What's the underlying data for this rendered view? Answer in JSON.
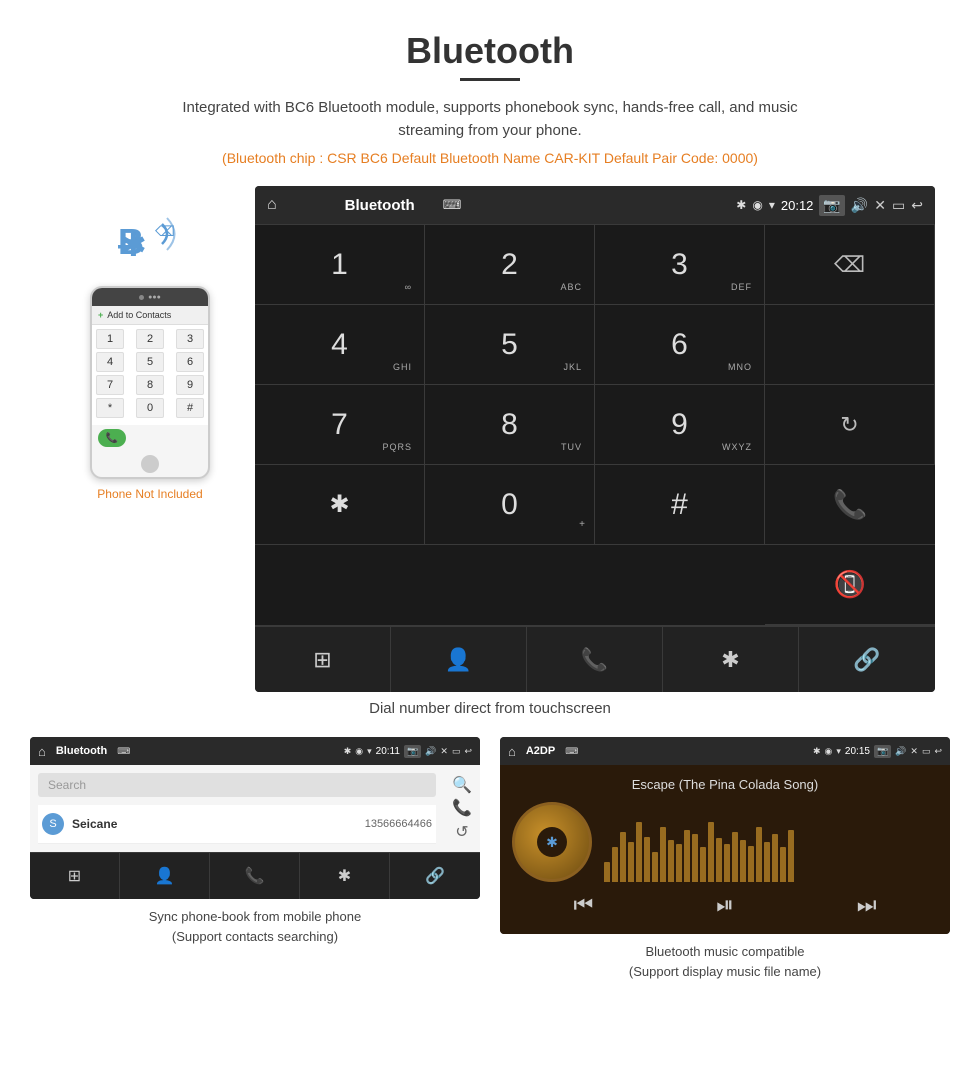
{
  "page": {
    "title": "Bluetooth",
    "subtitle": "Integrated with BC6 Bluetooth module, supports phonebook sync, hands-free call, and music streaming from your phone.",
    "orange_info": "(Bluetooth chip : CSR BC6    Default Bluetooth Name CAR-KIT    Default Pair Code: 0000)",
    "screen_caption": "Dial number direct from touchscreen",
    "bottom_left_caption": "Sync phone-book from mobile phone\n(Support contacts searching)",
    "bottom_right_caption": "Bluetooth music compatible\n(Support display music file name)",
    "phone_not_included": "Phone Not Included"
  },
  "car_screen": {
    "status_bar": {
      "title": "Bluetooth",
      "usb_icon": "⌨",
      "time": "20:12",
      "icons": [
        "📷",
        "🔊",
        "✕",
        "▭",
        "↩"
      ]
    },
    "dialpad": [
      {
        "digit": "1",
        "sub": "∞"
      },
      {
        "digit": "2",
        "sub": "ABC"
      },
      {
        "digit": "3",
        "sub": "DEF"
      },
      {
        "digit": "",
        "sub": "",
        "special": "backspace"
      },
      {
        "digit": "4",
        "sub": "GHI"
      },
      {
        "digit": "5",
        "sub": "JKL"
      },
      {
        "digit": "6",
        "sub": "MNO"
      },
      {
        "digit": "",
        "sub": "",
        "special": "empty"
      },
      {
        "digit": "7",
        "sub": "PQRS"
      },
      {
        "digit": "8",
        "sub": "TUV"
      },
      {
        "digit": "9",
        "sub": "WXYZ"
      },
      {
        "digit": "",
        "sub": "",
        "special": "refresh"
      },
      {
        "digit": "*",
        "sub": ""
      },
      {
        "digit": "0",
        "sub": "+"
      },
      {
        "digit": "#",
        "sub": ""
      },
      {
        "digit": "",
        "sub": "",
        "special": "call-green"
      },
      {
        "digit": "",
        "sub": "",
        "special": "call-red"
      }
    ],
    "toolbar_icons": [
      "⊞",
      "👤",
      "📞",
      "✱",
      "🔗"
    ]
  },
  "phonebook_screen": {
    "status_bar": {
      "title": "Bluetooth",
      "time": "20:11"
    },
    "search_placeholder": "Search",
    "contacts": [
      {
        "letter": "S",
        "name": "Seicane",
        "number": "13566664466"
      }
    ],
    "side_icons": [
      "🔍",
      "📞",
      "↺"
    ],
    "toolbar_icons": [
      "⊞",
      "👤",
      "📞",
      "✱",
      "🔗"
    ]
  },
  "music_screen": {
    "status_bar": {
      "title": "A2DP",
      "time": "20:15"
    },
    "song_title": "Escape (The Pina Colada Song)",
    "viz_bars": [
      20,
      35,
      50,
      40,
      60,
      45,
      30,
      55,
      42,
      38,
      52,
      48,
      35,
      60,
      44,
      38,
      50,
      42,
      36,
      55,
      40,
      48,
      35,
      52
    ],
    "controls": [
      "⏮",
      "⏯",
      "⏭"
    ]
  }
}
